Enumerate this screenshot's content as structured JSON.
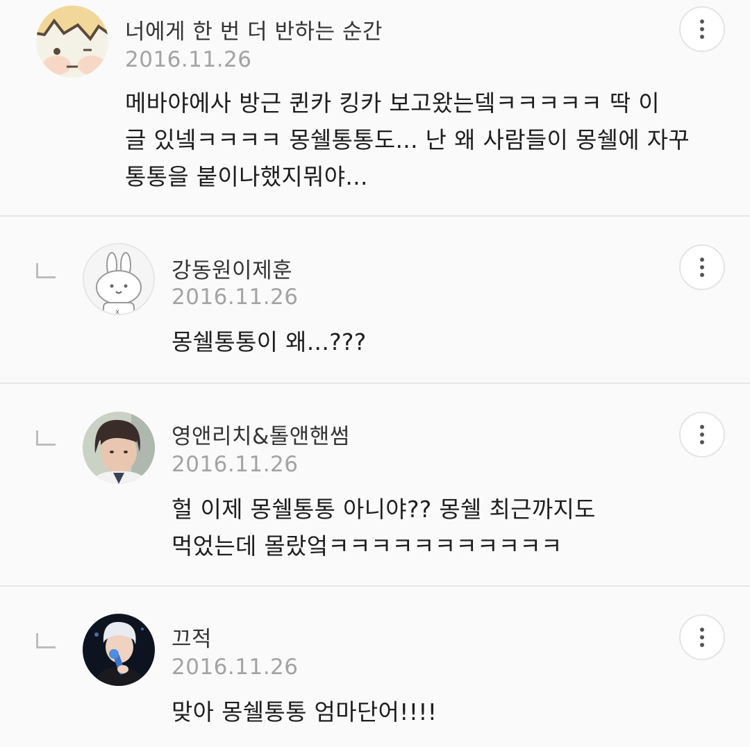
{
  "comments": [
    {
      "author": "너에게 한 번 더 반하는 순간",
      "date": "2016.11.26",
      "body": "메바야에사 방근 퀸카 킹카 보고왔는뎈ㅋㅋㅋㅋㅋ 딱 이\n글 있넼ㅋㅋㅋㅋ 몽쉘통통도... 난 왜 사람들이 몽쉘에 자꾸\n통통을 붙이나했지뭐야...",
      "avatar_icon": "cat-character-icon",
      "is_reply": false
    },
    {
      "author": "강동원이제훈",
      "date": "2016.11.26",
      "body": "몽쉘통통이 왜...???",
      "avatar_icon": "rabbit-character-icon",
      "is_reply": true
    },
    {
      "author": "영앤리치&톨앤핸썸",
      "date": "2016.11.26",
      "body": "헐 이제 몽쉘통통 아니야?? 몽쉘 최근까지도\n먹었는데 몰랐엌ㅋㅋㅋㅋㅋㅋㅋㅋㅋㅋㅋ",
      "avatar_icon": "person-photo-icon",
      "is_reply": true
    },
    {
      "author": "끄적",
      "date": "2016.11.26",
      "body": "맞아 몽쉘통통 엄마단어!!!!",
      "avatar_icon": "person-photo-icon",
      "is_reply": true
    }
  ],
  "more_icon": "more-vertical-icon",
  "reply_icon": "reply-arrow-icon",
  "colors": {
    "background": "#fafafa",
    "divider": "#e6e6e6",
    "date": "#a3a3a3",
    "author": "#333333"
  }
}
